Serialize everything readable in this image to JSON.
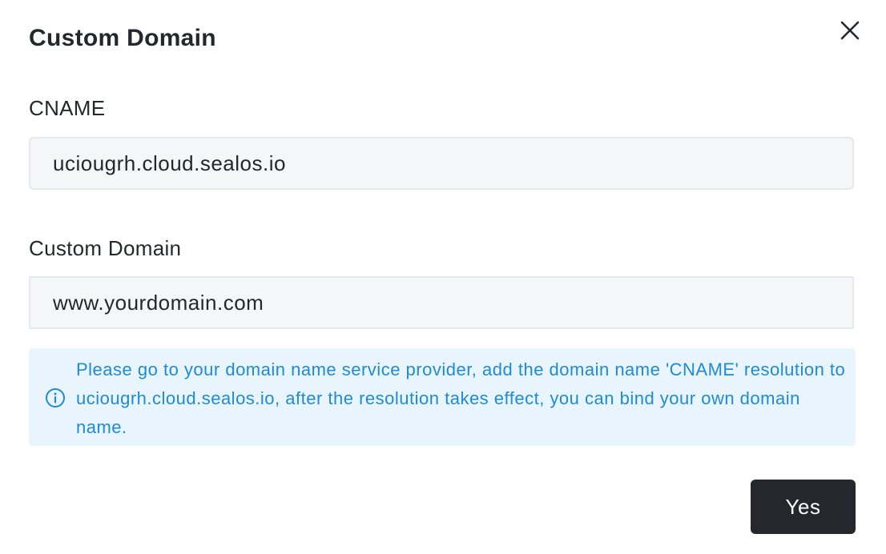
{
  "dialog": {
    "title": "Custom Domain",
    "close_icon": "close-icon"
  },
  "cname": {
    "label": "CNAME",
    "value": "uciougrh.cloud.sealos.io"
  },
  "custom_domain": {
    "label": "Custom Domain",
    "placeholder": "www.yourdomain.com",
    "value": ""
  },
  "alert": {
    "icon": "info-icon",
    "text": "Please go to your domain name service provider, add the domain name 'CNAME' resolution to uciougrh.cloud.sealos.io, after the resolution takes effect, you can bind your own domain name."
  },
  "footer": {
    "confirm_label": "Yes"
  },
  "colors": {
    "primary_button": "#24282c",
    "info_text": "#1f8ad6",
    "info_background": "#e9f5fd",
    "input_background": "#f4f6f8"
  }
}
